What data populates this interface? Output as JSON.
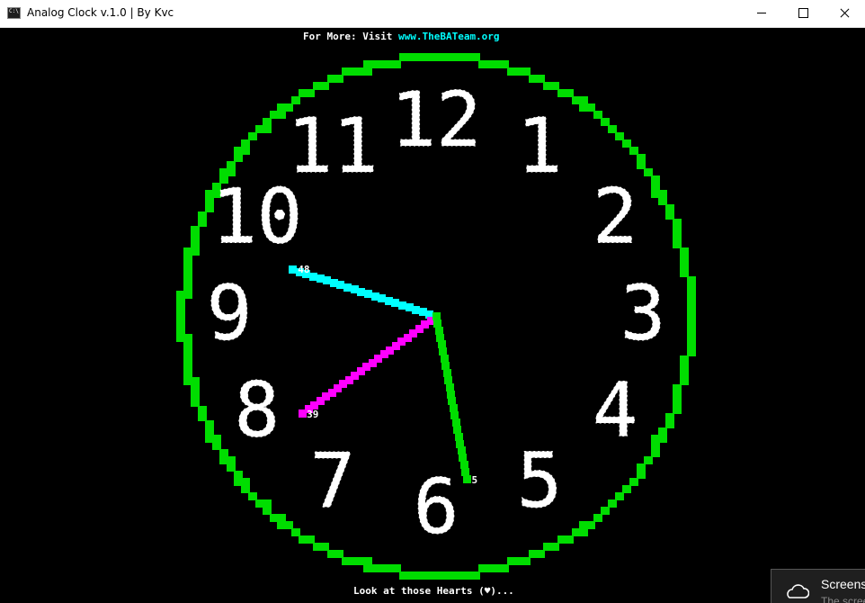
{
  "window": {
    "title": "Analog Clock v.1.0 | By Kvc"
  },
  "console": {
    "header_prefix": "For More: Visit ",
    "header_link": "www.TheBATeam.org",
    "footer": "Look at those Hearts (♥)..."
  },
  "clock": {
    "hours": [
      "12",
      "1",
      "2",
      "3",
      "4",
      "5",
      "6",
      "7",
      "8",
      "9",
      "10",
      "11"
    ],
    "time": {
      "hour": 5,
      "minute": 39,
      "second": 48
    },
    "hand_labels": {
      "hour": "5",
      "minute": "39",
      "second": "48"
    },
    "glyph": "♥",
    "colors": {
      "rim": "#00dd00",
      "hour_hand": "#00dd00",
      "minute_hand": "#ff00ff",
      "second_hand": "#00ffff",
      "numerals": "#ffffff",
      "header_link": "#00ffff",
      "text": "#ffffff"
    }
  },
  "toast": {
    "title": "Screenshot saved",
    "body": "The screenshot was added to your OneDrive."
  }
}
